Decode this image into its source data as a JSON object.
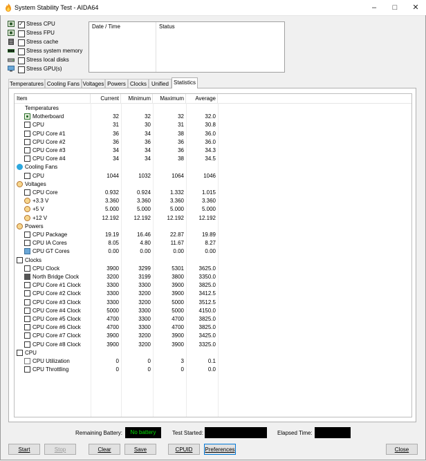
{
  "window": {
    "title": "System Stability Test - AIDA64"
  },
  "stress": [
    {
      "label": "Stress CPU",
      "checked": true,
      "icon": "cpu-chip-icon"
    },
    {
      "label": "Stress FPU",
      "checked": false,
      "icon": "fpu-chip-icon"
    },
    {
      "label": "Stress cache",
      "checked": false,
      "icon": "cache-icon"
    },
    {
      "label": "Stress system memory",
      "checked": false,
      "icon": "memory-icon"
    },
    {
      "label": "Stress local disks",
      "checked": false,
      "icon": "disk-icon"
    },
    {
      "label": "Stress GPU(s)",
      "checked": false,
      "icon": "gpu-icon"
    }
  ],
  "log": {
    "col_date": "Date / Time",
    "col_status": "Status"
  },
  "tabs": [
    "Temperatures",
    "Cooling Fans",
    "Voltages",
    "Powers",
    "Clocks",
    "Unified",
    "Statistics"
  ],
  "active_tab": "Statistics",
  "grid": {
    "columns": [
      "Item",
      "Current",
      "Minimum",
      "Maximum",
      "Average"
    ],
    "rows": [
      {
        "group": true,
        "label": "Temperatures",
        "icon": "thermometer-icon"
      },
      {
        "label": "Motherboard",
        "icon": "motherboard-icon",
        "v": [
          "32",
          "32",
          "32",
          "32.0"
        ]
      },
      {
        "label": "CPU",
        "icon": "cpu-icon",
        "v": [
          "31",
          "30",
          "31",
          "30.8"
        ]
      },
      {
        "label": "CPU Core #1",
        "icon": "cpu-icon",
        "v": [
          "36",
          "34",
          "38",
          "36.0"
        ]
      },
      {
        "label": "CPU Core #2",
        "icon": "cpu-icon",
        "v": [
          "36",
          "36",
          "36",
          "36.0"
        ]
      },
      {
        "label": "CPU Core #3",
        "icon": "cpu-icon",
        "v": [
          "34",
          "34",
          "36",
          "34.3"
        ]
      },
      {
        "label": "CPU Core #4",
        "icon": "cpu-icon",
        "v": [
          "34",
          "34",
          "38",
          "34.5"
        ]
      },
      {
        "group": true,
        "label": "Cooling Fans",
        "icon": "fan-icon"
      },
      {
        "label": "CPU",
        "icon": "cpu-icon",
        "v": [
          "1044",
          "1032",
          "1064",
          "1046"
        ]
      },
      {
        "group": true,
        "label": "Voltages",
        "icon": "voltage-icon"
      },
      {
        "label": "CPU Core",
        "icon": "cpu-icon",
        "v": [
          "0.932",
          "0.924",
          "1.332",
          "1.015"
        ]
      },
      {
        "label": "+3.3 V",
        "icon": "voltage-icon",
        "v": [
          "3.360",
          "3.360",
          "3.360",
          "3.360"
        ]
      },
      {
        "label": "+5 V",
        "icon": "voltage-icon",
        "v": [
          "5.000",
          "5.000",
          "5.000",
          "5.000"
        ]
      },
      {
        "label": "+12 V",
        "icon": "voltage-icon",
        "v": [
          "12.192",
          "12.192",
          "12.192",
          "12.192"
        ]
      },
      {
        "group": true,
        "label": "Powers",
        "icon": "voltage-icon"
      },
      {
        "label": "CPU Package",
        "icon": "cpu-icon",
        "v": [
          "19.19",
          "16.46",
          "22.87",
          "19.89"
        ]
      },
      {
        "label": "CPU IA Cores",
        "icon": "cpu-icon",
        "v": [
          "8.05",
          "4.80",
          "11.67",
          "8.27"
        ]
      },
      {
        "label": "CPU GT Cores",
        "icon": "gpu-icon",
        "v": [
          "0.00",
          "0.00",
          "0.00",
          "0.00"
        ]
      },
      {
        "group": true,
        "label": "Clocks",
        "icon": "clock-icon"
      },
      {
        "label": "CPU Clock",
        "icon": "cpu-icon",
        "v": [
          "3900",
          "3299",
          "5301",
          "3625.0"
        ]
      },
      {
        "label": "North Bridge Clock",
        "icon": "northbridge-icon",
        "v": [
          "3200",
          "3199",
          "3800",
          "3350.0"
        ]
      },
      {
        "label": "CPU Core #1 Clock",
        "icon": "cpu-icon",
        "v": [
          "3300",
          "3300",
          "3900",
          "3825.0"
        ]
      },
      {
        "label": "CPU Core #2 Clock",
        "icon": "cpu-icon",
        "v": [
          "3300",
          "3200",
          "3900",
          "3412.5"
        ]
      },
      {
        "label": "CPU Core #3 Clock",
        "icon": "cpu-icon",
        "v": [
          "3300",
          "3200",
          "5000",
          "3512.5"
        ]
      },
      {
        "label": "CPU Core #4 Clock",
        "icon": "cpu-icon",
        "v": [
          "5000",
          "3300",
          "5000",
          "4150.0"
        ]
      },
      {
        "label": "CPU Core #5 Clock",
        "icon": "cpu-icon",
        "v": [
          "4700",
          "3300",
          "4700",
          "3825.0"
        ]
      },
      {
        "label": "CPU Core #6 Clock",
        "icon": "cpu-icon",
        "v": [
          "4700",
          "3300",
          "4700",
          "3825.0"
        ]
      },
      {
        "label": "CPU Core #7 Clock",
        "icon": "cpu-icon",
        "v": [
          "3900",
          "3200",
          "3900",
          "3425.0"
        ]
      },
      {
        "label": "CPU Core #8 Clock",
        "icon": "cpu-icon",
        "v": [
          "3900",
          "3200",
          "3900",
          "3325.0"
        ]
      },
      {
        "group": true,
        "label": "CPU",
        "icon": "cpu-icon"
      },
      {
        "label": "CPU Utilization",
        "icon": "hourglass-icon",
        "v": [
          "0",
          "0",
          "3",
          "0.1"
        ]
      },
      {
        "label": "CPU Throttling",
        "icon": "cpu-icon",
        "v": [
          "0",
          "0",
          "0",
          "0.0"
        ]
      }
    ]
  },
  "status": {
    "battery_label": "Remaining Battery:",
    "battery_value": "No battery",
    "started_label": "Test Started:",
    "elapsed_label": "Elapsed Time:"
  },
  "buttons": {
    "start": "Start",
    "stop": "Stop",
    "clear": "Clear",
    "save": "Save",
    "cpuid": "CPUID",
    "preferences": "Preferences",
    "close": "Close"
  }
}
